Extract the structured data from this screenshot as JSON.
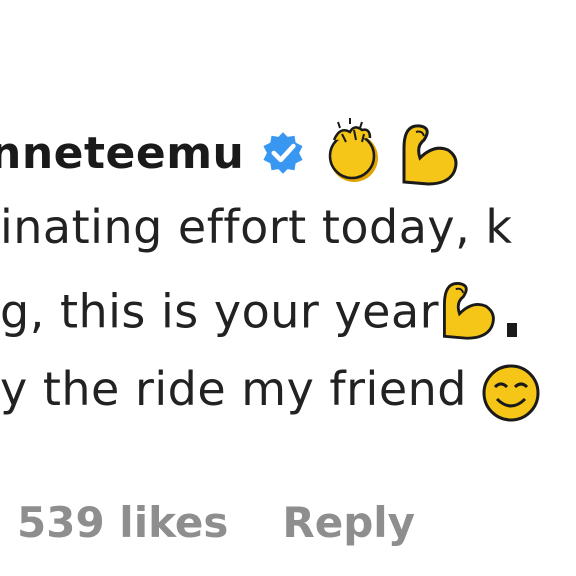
{
  "comment": {
    "username": "nneteemu",
    "lines": [
      "inating effort today, k",
      "g, this is your year",
      "y the ride my friend"
    ],
    "likes": "539 likes",
    "reply": "Reply"
  },
  "icons": {
    "verified": "verified-badge-icon",
    "clap": "clapping-hands-emoji",
    "muscle": "flexed-biceps-emoji",
    "smile": "smiling-face-emoji"
  },
  "colors": {
    "verified_blue": "#3897f0",
    "emoji_yellow": "#f5c518",
    "meta_gray": "#8e8e8e"
  }
}
